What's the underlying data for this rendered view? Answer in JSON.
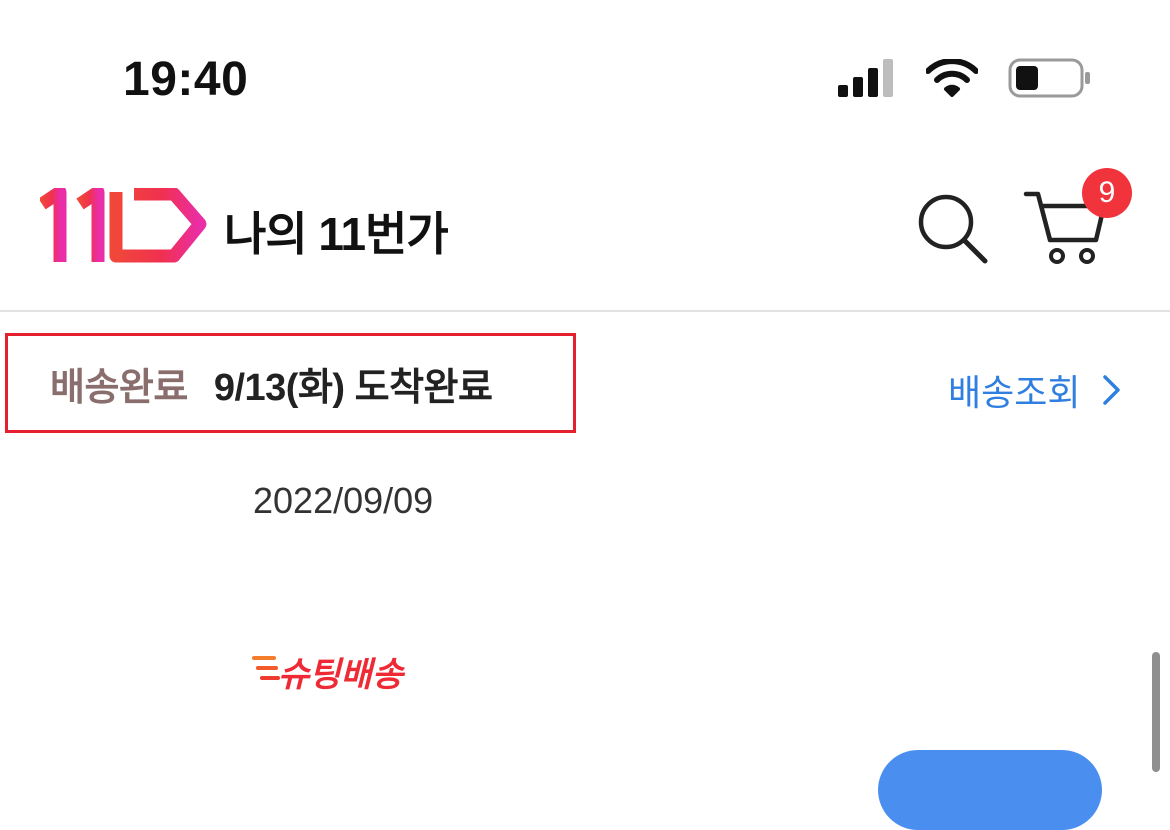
{
  "status_bar": {
    "time": "19:40",
    "icons": [
      "cellular-signal-icon",
      "wifi-icon",
      "battery-icon"
    ]
  },
  "header": {
    "logo": "11번가",
    "title": "나의 11번가",
    "search_icon": "search-icon",
    "cart_icon": "cart-icon",
    "cart_badge": "9"
  },
  "order": {
    "status_label": "배송완료",
    "arrival_text": "9/13(화) 도착완료",
    "track_link": "배송조회",
    "order_date": "2022/09/09",
    "delivery_badge": "슈팅배송"
  },
  "colors": {
    "accent_red": "#e5202e",
    "link_blue": "#2f7fe0",
    "badge_red": "#f1333b",
    "status_brown": "#8a6d6d"
  }
}
